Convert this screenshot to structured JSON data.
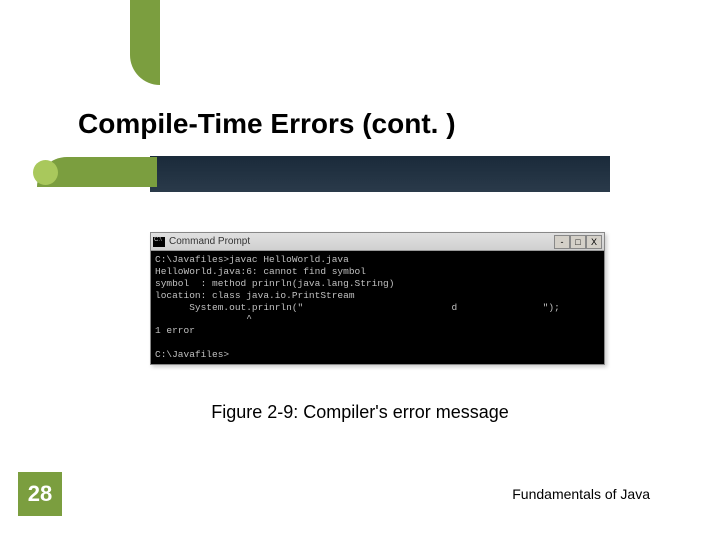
{
  "slide": {
    "title": "Compile-Time Errors (cont. )",
    "caption": "Figure 2-9: Compiler's error message",
    "page_number": "28",
    "footer": "Fundamentals of Java"
  },
  "cmd": {
    "title": "Command Prompt",
    "controls": {
      "min": "-",
      "max": "□",
      "close": "X"
    },
    "lines": [
      "C:\\Javafiles>javac HelloWorld.java",
      "HelloWorld.java:6: cannot find symbol",
      "symbol  : method prinrln(java.lang.String)",
      "location: class java.io.PrintStream",
      "      System.out.prinrln(\"                          d               \");",
      "                ^",
      "1 error",
      "",
      "C:\\Javafiles>"
    ]
  }
}
